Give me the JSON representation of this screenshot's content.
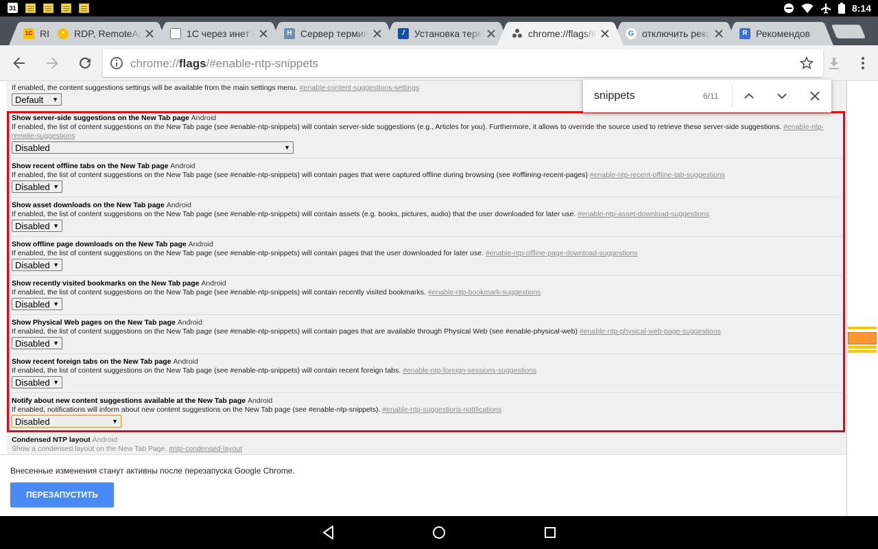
{
  "status_bar": {
    "calendar_day": "31",
    "clock": "8:14",
    "left_icons": [
      "calendar-icon",
      "notes-icon",
      "notes-icon",
      "notes-icon",
      "notes-icon"
    ],
    "right_icons": [
      "do-not-disturb-icon",
      "wifi-icon",
      "airplane-icon",
      "battery-icon"
    ]
  },
  "tabs": [
    {
      "title": "RI",
      "favicon": "1C",
      "favicon_color": "#f4c000",
      "active": false
    },
    {
      "title": "RDP, RemoteApp",
      "favicon": "•",
      "favicon_color": "#f4c000",
      "active": false
    },
    {
      "title": "1C через инет н",
      "favicon": "doc",
      "favicon_color": "#ffffff",
      "active": false
    },
    {
      "title": "Сервер термина",
      "favicon": "H",
      "favicon_color": "#6b90b0",
      "active": false
    },
    {
      "title": "Установка терм",
      "favicon": "/",
      "favicon_color": "#1a4fa0",
      "active": false
    },
    {
      "title": "chrome://flags/#",
      "favicon": "flags",
      "favicon_color": "#555555",
      "active": true
    },
    {
      "title": "отключить реко",
      "favicon": "G",
      "favicon_color": "#ffffff",
      "active": false
    },
    {
      "title": "Рекомендов",
      "favicon": "R",
      "favicon_color": "#3b6fd4",
      "active": false
    }
  ],
  "toolbar": {
    "url_scheme": "chrome://",
    "url_host": "flags",
    "url_path": "/#enable-ntp-snippets"
  },
  "find_bar": {
    "query": "snippets",
    "count": "6/11"
  },
  "top_partial_flag": {
    "description": "If enabled, the content suggestions settings will be available from the main settings menu.",
    "link": "#enable-content-suggestions-settings",
    "select_value": "Default"
  },
  "flags": [
    {
      "name": "Show server-side suggestions on the New Tab page",
      "platform": "Android",
      "description": "If enabled, the list of content suggestions on the New Tab page (see #enable-ntp-snippets) will contain server-side suggestions (e.g., Articles for you). Furthermore, it allows to override the source used to retrieve these server-side suggestions.",
      "link": "#enable-ntp-remote-suggestions",
      "select_value": "Disabled"
    },
    {
      "name": "Show recent offline tabs on the New Tab page",
      "platform": "Android",
      "description": "If enabled, the list of content suggestions on the New Tab page (see #enable-ntp-snippets) will contain pages that were captured offline during browsing (see #offlining-recent-pages)",
      "link": "#enable-ntp-recent-offline-tab-suggestions",
      "select_value": "Disabled"
    },
    {
      "name": "Show asset downloads on the New Tab page",
      "platform": "Android",
      "description": "If enabled, the list of content suggestions on the New Tab page (see #enable-ntp-snippets) will contain assets (e.g. books, pictures, audio) that the user downloaded for later use.",
      "link": "#enable-ntp-asset-download-suggestions",
      "select_value": "Disabled"
    },
    {
      "name": "Show offline page downloads on the New Tab page",
      "platform": "Android",
      "description": "If enabled, the list of content suggestions on the New Tab page (see #enable-ntp-snippets) will contain pages that the user downloaded for later use.",
      "link": "#enable-ntp-offline-page-download-suggestions",
      "select_value": "Disabled"
    },
    {
      "name": "Show recently visited bookmarks on the New Tab page",
      "platform": "Android",
      "description": "If enabled, the list of content suggestions on the New Tab page (see #enable-ntp-snippets) will contain recently visited bookmarks.",
      "link": "#enable-ntp-bookmark-suggestions",
      "select_value": "Disabled"
    },
    {
      "name": "Show Physical Web pages on the New Tab page",
      "platform": "Android",
      "description": "If enabled, the list of content suggestions on the New Tab page (see #enable-ntp-snippets) will contain pages that are available through Physical Web (see #enable-physical-web)",
      "link": "#enable-ntp-physical-web-page-suggestions",
      "select_value": "Disabled"
    },
    {
      "name": "Show recent foreign tabs on the New Tab page",
      "platform": "Android",
      "description": "If enabled, the list of content suggestions on the New Tab page (see #enable-ntp-snippets) will contain recent foreign tabs.",
      "link": "#enable-ntp-foreign-sessions-suggestions",
      "select_value": "Disabled"
    },
    {
      "name": "Notify about new content suggestions available at the New Tab page",
      "platform": "Android",
      "description": "If enabled, notifications will inform about new content suggestions on the New Tab page (see #enable-ntp-snippets).",
      "link": "#enable-ntp-suggestions-notifications",
      "select_value": "Disabled"
    }
  ],
  "bottom_partial_flag": {
    "name": "Condensed NTP layout",
    "platform": "Android",
    "description": "Show a condensed layout on the New Tab Page.",
    "link": "#ntp-condensed-layout"
  },
  "infobar": {
    "message": "Внесенные изменения станут активны после перезапуска Google Chrome.",
    "button": "ПЕРЕЗАПУСТИТЬ"
  },
  "colors": {
    "highlight_border": "#e8001b",
    "relaunch_button": "#4a8af4",
    "find_match_active": "#ff9633",
    "find_match": "#f5c800"
  }
}
